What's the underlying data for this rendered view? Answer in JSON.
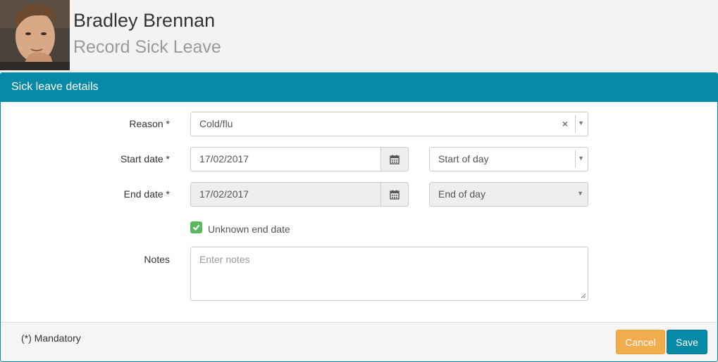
{
  "header": {
    "name": "Bradley Brennan",
    "subtitle": "Record Sick Leave"
  },
  "panel": {
    "title": "Sick leave details"
  },
  "form": {
    "reason_label": "Reason *",
    "reason_value": "Cold/flu",
    "start_label": "Start date *",
    "start_date": "17/02/2017",
    "start_time": "Start of day",
    "end_label": "End date *",
    "end_date": "17/02/2017",
    "end_time": "End of day",
    "unknown_end_label": "Unknown end date",
    "unknown_end_checked": true,
    "notes_label": "Notes",
    "notes_placeholder": "Enter notes"
  },
  "footer": {
    "mandatory_note": "(*) Mandatory",
    "cancel_label": "Cancel",
    "save_label": "Save"
  },
  "colors": {
    "primary": "#0889a6",
    "warning": "#f0ad4e",
    "success": "#5cb85c"
  },
  "icons": {
    "calendar": "calendar-icon",
    "check": "check-icon",
    "clear": "clear-icon",
    "dropdown": "chevron-down-icon"
  }
}
